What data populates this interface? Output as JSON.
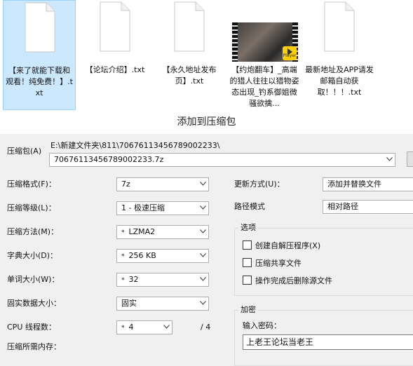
{
  "files": [
    {
      "label": "【来了就能下载和观看！纯免费！】.txt",
      "selected": true,
      "thumbnail": false
    },
    {
      "label": "【论坛介绍】.txt",
      "selected": false,
      "thumbnail": false
    },
    {
      "label": "【永久地址发布页】.txt",
      "selected": false,
      "thumbnail": false
    },
    {
      "label": "【约炮翻车】_高端的猎人往往以猎物姿态出现_钓系御姐微骚欲擒...",
      "selected": false,
      "thumbnail": true,
      "badge": "Player"
    },
    {
      "label": "最新地址及APP请发邮箱自动获取！！！.txt",
      "selected": false,
      "thumbnail": false
    }
  ],
  "dialog": {
    "title": "添加到压缩包",
    "archive": {
      "label": "压缩包(A)",
      "path": "E:\\新建文件夹\\811\\70676113456789002233\\",
      "name": "70676113456789002233.7z"
    },
    "left": {
      "format": {
        "label": "压缩格式(F)：",
        "value": "7z"
      },
      "level": {
        "label": "压缩等级(L)：",
        "value": "1 - 极速压缩"
      },
      "method": {
        "label": "压缩方法(M)：",
        "value": "LZMA2"
      },
      "dict": {
        "label": "字典大小(D)：",
        "value": "256 KB"
      },
      "word": {
        "label": "单词大小(W)：",
        "value": "32"
      },
      "solid": {
        "label": "固实数据大小：",
        "value": "固实"
      },
      "threads": {
        "label": "CPU 线程数：",
        "value": "4",
        "total": "/ 4"
      },
      "memory": {
        "label": "压缩所需内存："
      }
    },
    "right": {
      "update": {
        "label": "更新方式(U)：",
        "value": "添加并替换文件"
      },
      "pathmode": {
        "label": "路径模式",
        "value": "相对路径"
      },
      "options": {
        "title": "选项",
        "sfx": "创建自解压程序(X)",
        "shared": "压缩共享文件",
        "delete": "操作完成后删除源文件"
      },
      "encrypt": {
        "title": "加密",
        "pwd_label": "输入密码：",
        "pwd_value": "上老王论坛当老王"
      }
    }
  }
}
